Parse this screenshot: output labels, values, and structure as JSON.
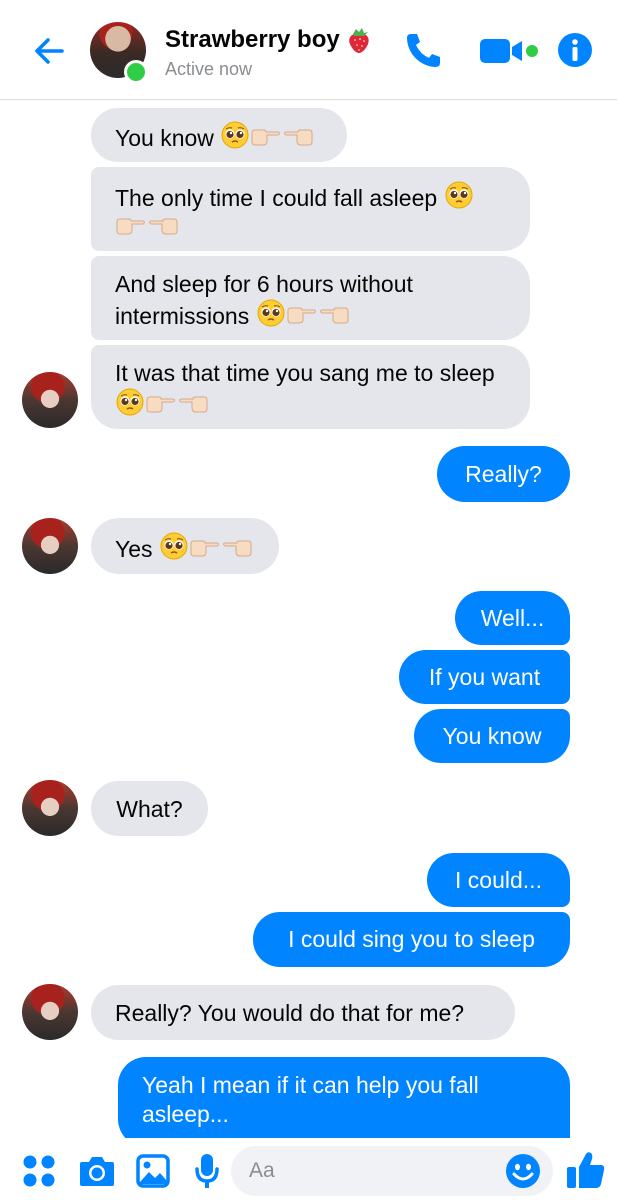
{
  "header": {
    "title": "Strawberry boy",
    "status": "Active now",
    "title_emoji": "strawberry-emoji"
  },
  "messages": [
    {
      "from": "them",
      "text": "You know"
    },
    {
      "from": "them",
      "text": "The only time I could fall asleep"
    },
    {
      "from": "them",
      "text": "And sleep for 6 hours without intermissions"
    },
    {
      "from": "them",
      "text": "It was that time you sang me to sleep"
    },
    {
      "from": "me",
      "text": "Really?"
    },
    {
      "from": "them",
      "text": "Yes"
    },
    {
      "from": "me",
      "text": "Well..."
    },
    {
      "from": "me",
      "text": "If you want"
    },
    {
      "from": "me",
      "text": "You know"
    },
    {
      "from": "them",
      "text": "What?"
    },
    {
      "from": "me",
      "text": "I could..."
    },
    {
      "from": "me",
      "text": "I could sing you to sleep"
    },
    {
      "from": "them",
      "text": "Really? You would do that for me?"
    },
    {
      "from": "me",
      "text": "Yeah I mean if it can help you fall asleep..."
    }
  ],
  "emoji_suffix": "pleading-face-emoji, backhand-index-pointing-right-emoji, backhand-index-pointing-left-emoji",
  "composer": {
    "placeholder": "Aa"
  },
  "colors": {
    "accent": "#0084ff",
    "incoming_bubble": "#e4e6eb",
    "active_green": "#31cc46"
  },
  "icons": {
    "header": [
      "back-arrow-icon",
      "phone-icon",
      "video-camera-icon",
      "info-icon"
    ],
    "bottom": [
      "apps-grid-icon",
      "camera-icon",
      "image-icon",
      "microphone-icon",
      "smiley-icon",
      "thumbs-up-icon"
    ]
  }
}
